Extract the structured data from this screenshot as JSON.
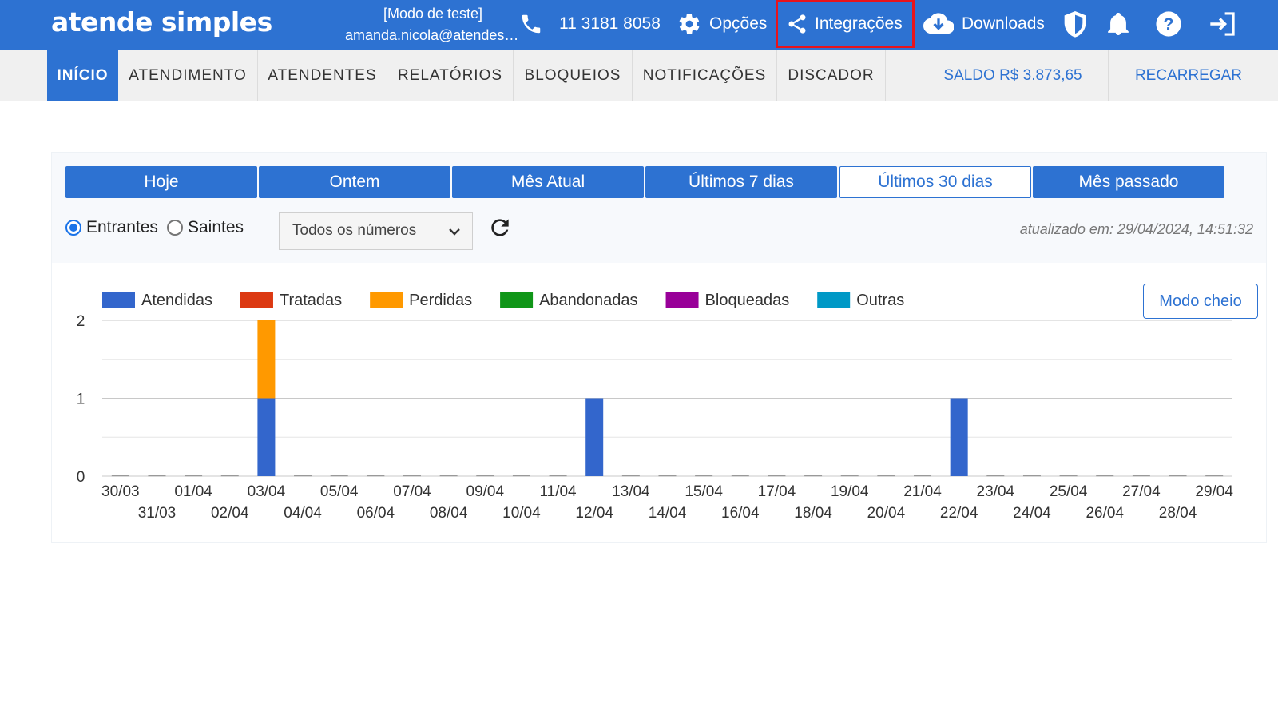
{
  "header": {
    "logo": "atende simples",
    "mode": "[Modo de teste]",
    "user": "amanda.nicola@atendesimples.com",
    "phone": "11 3181 8058",
    "options": "Opções",
    "integrations": "Integrações",
    "downloads": "Downloads",
    "icons": [
      "phone-icon",
      "gear-icon",
      "share-icon",
      "cloud-download-icon",
      "shield-icon",
      "bell-icon",
      "help-icon",
      "logout-icon"
    ]
  },
  "nav": {
    "tabs": [
      "INÍCIO",
      "ATENDIMENTO",
      "ATENDENTES",
      "RELATÓRIOS",
      "BLOQUEIOS",
      "NOTIFICAÇÕES",
      "DISCADOR"
    ],
    "active": "INÍCIO",
    "balance": "SALDO R$ 3.873,65",
    "recharge": "RECARREGAR"
  },
  "periods": [
    "Hoje",
    "Ontem",
    "Mês Atual",
    "Últimos 7 dias",
    "Últimos 30 dias",
    "Mês passado"
  ],
  "selected_period": "Últimos 30 dias",
  "direction": {
    "incoming": "Entrantes",
    "outgoing": "Saintes",
    "selected": "Entrantes"
  },
  "number_filter": {
    "value": "Todos os números"
  },
  "updated_at": "atualizado em: 29/04/2024, 14:51:32",
  "full_mode": "Modo cheio",
  "colors": {
    "primary": "#2d72d2",
    "highlight": "#e8141c"
  },
  "chart_data": {
    "type": "bar",
    "stacked": true,
    "categories": [
      "30/03",
      "31/03",
      "01/04",
      "02/04",
      "03/04",
      "04/04",
      "05/04",
      "06/04",
      "07/04",
      "08/04",
      "09/04",
      "10/04",
      "11/04",
      "12/04",
      "13/04",
      "14/04",
      "15/04",
      "16/04",
      "17/04",
      "18/04",
      "19/04",
      "20/04",
      "21/04",
      "22/04",
      "23/04",
      "24/04",
      "25/04",
      "26/04",
      "27/04",
      "28/04",
      "29/04"
    ],
    "series": [
      {
        "name": "Atendidas",
        "color": "#3366cc",
        "values": [
          0,
          0,
          0,
          0,
          1,
          0,
          0,
          0,
          0,
          0,
          0,
          0,
          0,
          1,
          0,
          0,
          0,
          0,
          0,
          0,
          0,
          0,
          0,
          1,
          0,
          0,
          0,
          0,
          0,
          0,
          0
        ]
      },
      {
        "name": "Tratadas",
        "color": "#dc3912",
        "values": [
          0,
          0,
          0,
          0,
          0,
          0,
          0,
          0,
          0,
          0,
          0,
          0,
          0,
          0,
          0,
          0,
          0,
          0,
          0,
          0,
          0,
          0,
          0,
          0,
          0,
          0,
          0,
          0,
          0,
          0,
          0
        ]
      },
      {
        "name": "Perdidas",
        "color": "#ff9900",
        "values": [
          0,
          0,
          0,
          0,
          1,
          0,
          0,
          0,
          0,
          0,
          0,
          0,
          0,
          0,
          0,
          0,
          0,
          0,
          0,
          0,
          0,
          0,
          0,
          0,
          0,
          0,
          0,
          0,
          0,
          0,
          0
        ]
      },
      {
        "name": "Abandonadas",
        "color": "#109618",
        "values": [
          0,
          0,
          0,
          0,
          0,
          0,
          0,
          0,
          0,
          0,
          0,
          0,
          0,
          0,
          0,
          0,
          0,
          0,
          0,
          0,
          0,
          0,
          0,
          0,
          0,
          0,
          0,
          0,
          0,
          0,
          0
        ]
      },
      {
        "name": "Bloqueadas",
        "color": "#990099",
        "values": [
          0,
          0,
          0,
          0,
          0,
          0,
          0,
          0,
          0,
          0,
          0,
          0,
          0,
          0,
          0,
          0,
          0,
          0,
          0,
          0,
          0,
          0,
          0,
          0,
          0,
          0,
          0,
          0,
          0,
          0,
          0
        ]
      },
      {
        "name": "Outras",
        "color": "#0099c6",
        "values": [
          0,
          0,
          0,
          0,
          0,
          0,
          0,
          0,
          0,
          0,
          0,
          0,
          0,
          0,
          0,
          0,
          0,
          0,
          0,
          0,
          0,
          0,
          0,
          0,
          0,
          0,
          0,
          0,
          0,
          0,
          0
        ]
      }
    ],
    "yticks": [
      0,
      1,
      2
    ],
    "ylim": [
      0,
      2
    ],
    "legend": "top-left",
    "grid": true
  }
}
